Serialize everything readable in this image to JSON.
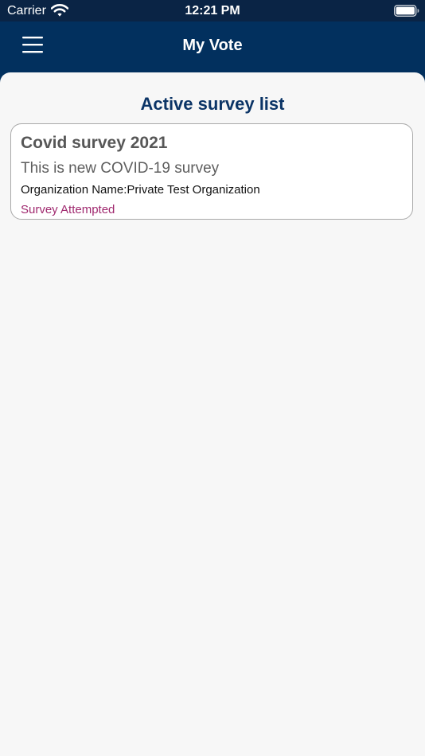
{
  "status_bar": {
    "carrier": "Carrier",
    "time": "12:21 PM",
    "wifi_icon": "wifi-icon",
    "battery_icon": "battery-icon"
  },
  "nav": {
    "menu_icon": "hamburger-menu-icon",
    "title": "My Vote"
  },
  "main": {
    "section_title": "Active survey list",
    "surveys": [
      {
        "title": "Covid survey 2021",
        "description": "This is new COVID-19 survey",
        "organization": "Organization Name:Private Test Organization",
        "status": "Survey Attempted"
      }
    ]
  },
  "colors": {
    "nav_background": "#02305e",
    "title_accent": "#0b3466",
    "status_accent": "#a0296f",
    "page_background": "#f7f7f7"
  }
}
